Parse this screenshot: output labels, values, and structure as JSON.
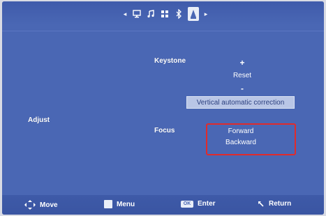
{
  "tabs": {
    "items": [
      "display-icon",
      "music-icon",
      "grid-icon",
      "bluetooth-icon",
      "settings-icon"
    ],
    "active_index": 4
  },
  "adjust": {
    "section_label": "Adjust",
    "keystone_label": "Keystone",
    "keystone_plus": "+",
    "keystone_reset": "Reset",
    "keystone_minus": "-",
    "auto_correction": "Vertical automatic correction",
    "focus_label": "Focus",
    "focus_forward": "Forward",
    "focus_backward": "Backward"
  },
  "footer": {
    "move": "Move",
    "menu": "Menu",
    "ok_key": "OK",
    "enter": "Enter",
    "return": "Return"
  },
  "colors": {
    "background": "#4a67b4",
    "highlight_box": "#e12b2b",
    "selected_item": "#b9c6e6"
  }
}
